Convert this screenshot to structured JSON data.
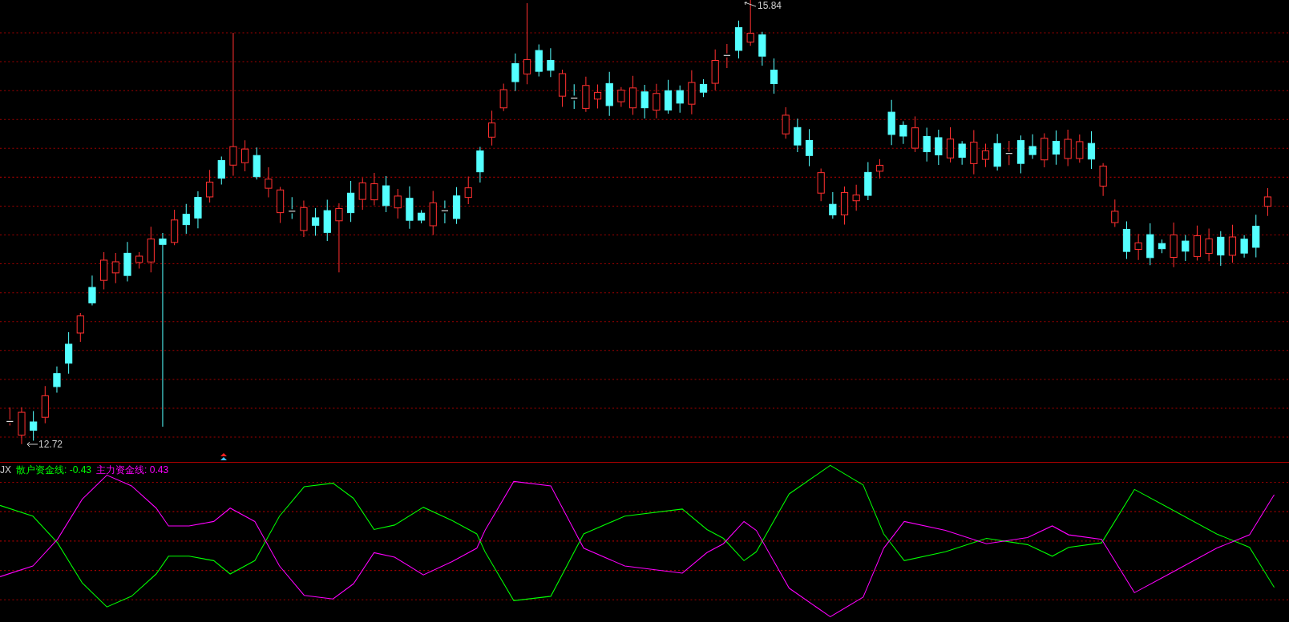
{
  "price_chart": {
    "high_label": "15.84",
    "low_label": "12.72"
  },
  "indicator": {
    "name": "JX",
    "series": [
      {
        "label": "散户资金线: -0.43",
        "color": "#00ff00"
      },
      {
        "label": "主力资金线: 0.43",
        "color": "#ff00ff"
      }
    ]
  }
}
